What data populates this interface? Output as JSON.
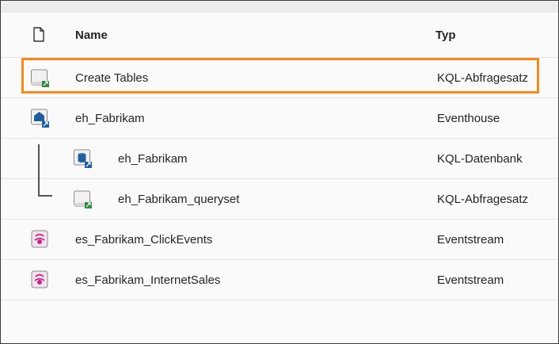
{
  "columns": {
    "icon": "document-icon",
    "name": "Name",
    "type": "Typ"
  },
  "rows": [
    {
      "name": "Create Tables",
      "type": "KQL-Abfragesatz",
      "icon": "kql-queryset-icon",
      "selected": true,
      "level": 0
    },
    {
      "name": "eh_Fabrikam",
      "type": "Eventhouse",
      "icon": "eventhouse-icon",
      "selected": false,
      "level": 0
    },
    {
      "name": "eh_Fabrikam",
      "type": "KQL-Datenbank",
      "icon": "kql-database-icon",
      "selected": false,
      "level": 1
    },
    {
      "name": "eh_Fabrikam_queryset",
      "type": "KQL-Abfragesatz",
      "icon": "kql-queryset-icon",
      "selected": false,
      "level": 1
    },
    {
      "name": "es_Fabrikam_ClickEvents",
      "type": "Eventstream",
      "icon": "eventstream-icon",
      "selected": false,
      "level": 0
    },
    {
      "name": "es_Fabrikam_InternetSales",
      "type": "Eventstream",
      "icon": "eventstream-icon",
      "selected": false,
      "level": 0
    }
  ],
  "colors": {
    "selection_border": "#f7891b",
    "eventhouse": "#1f5f9e",
    "eventstream": "#c3268a",
    "shortcut": "#2e8b3e"
  }
}
